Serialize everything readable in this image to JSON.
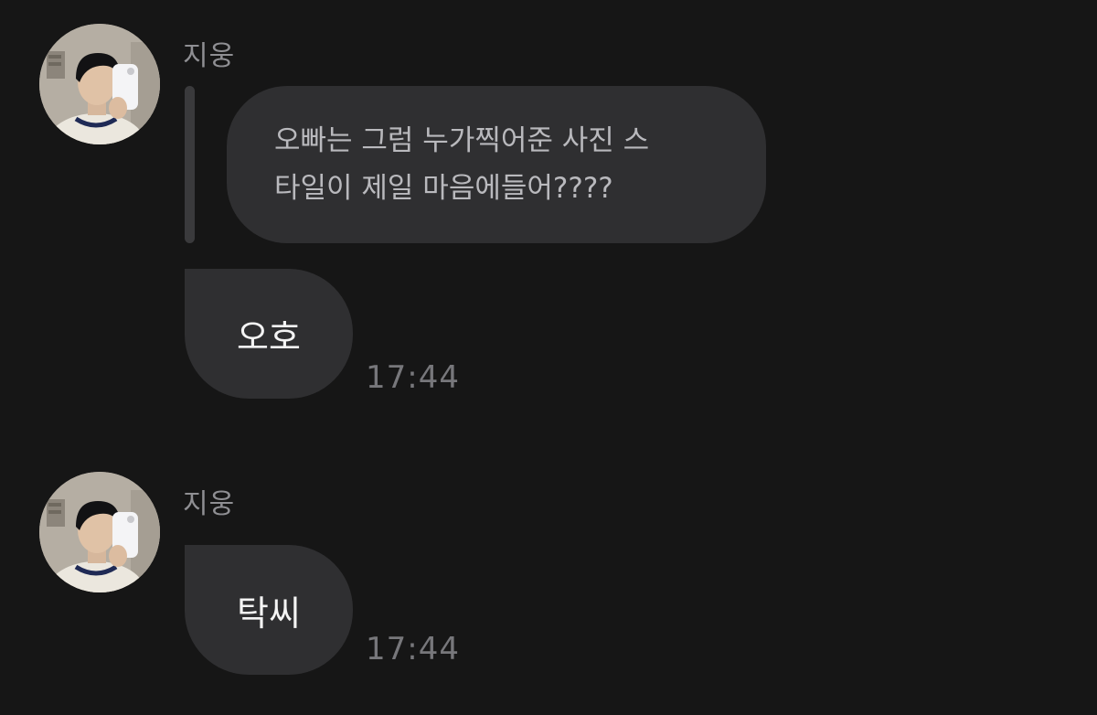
{
  "messages": [
    {
      "sender": "지웅",
      "quote": {
        "line1": "오빠는 그럼 누가찍어준 사진 스",
        "line2": "타일이 제일 마음에들어????"
      },
      "text": "오호",
      "time": "17:44"
    },
    {
      "sender": "지웅",
      "text": "탁씨",
      "time": "17:44"
    }
  ],
  "colors": {
    "background": "#161616",
    "bubble": "#2f2f31",
    "quote_bar": "#3a3a3c",
    "sender_name": "#8f8f93",
    "timestamp": "#77777b"
  },
  "icons": {
    "avatar": "profile-photo-avatar"
  }
}
